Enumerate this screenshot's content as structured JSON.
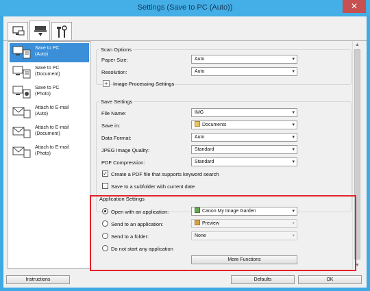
{
  "window": {
    "title": "Settings (Save to PC (Auto))",
    "close_glyph": "✕"
  },
  "tabs": [
    {
      "name": "scan-from-computer-icon",
      "active": false
    },
    {
      "name": "scan-from-operation-panel-icon",
      "active": true
    },
    {
      "name": "general-settings-tools-icon",
      "active": false
    }
  ],
  "left_list": {
    "items": [
      {
        "label_line1": "Save to PC",
        "label_line2": "(Auto)",
        "icon": "save-to-pc-icon",
        "selected": true
      },
      {
        "label_line1": "Save to PC",
        "label_line2": "(Document)",
        "icon": "save-to-pc-icon",
        "selected": false
      },
      {
        "label_line1": "Save to PC",
        "label_line2": "(Photo)",
        "icon": "save-to-pc-icon",
        "selected": false
      },
      {
        "label_line1": "Attach to E-mail",
        "label_line2": "(Auto)",
        "icon": "attach-email-icon",
        "selected": false
      },
      {
        "label_line1": "Attach to E-mail",
        "label_line2": "(Document)",
        "icon": "attach-email-icon",
        "selected": false
      },
      {
        "label_line1": "Attach to E-mail",
        "label_line2": "(Photo)",
        "icon": "attach-email-icon",
        "selected": false
      }
    ]
  },
  "scan_options": {
    "title": "Scan Options",
    "paper_size_label": "Paper Size:",
    "paper_size_value": "Auto",
    "resolution_label": "Resolution:",
    "resolution_value": "Auto",
    "image_processing_label": "Image Processing Settings",
    "expand_glyph": "+"
  },
  "save_settings": {
    "title": "Save Settings",
    "file_name_label": "File Name:",
    "file_name_value": "IMG",
    "save_in_label": "Save in:",
    "save_in_value": "Documents",
    "data_format_label": "Data Format:",
    "data_format_value": "Auto",
    "jpeg_quality_label": "JPEG Image Quality:",
    "jpeg_quality_value": "Standard",
    "pdf_compression_label": "PDF Compression:",
    "pdf_compression_value": "Standard",
    "keyword_pdf_label": "Create a PDF file that supports keyword search",
    "keyword_pdf_checked": true,
    "subfolder_label": "Save to a subfolder with current date",
    "subfolder_checked": false,
    "check_glyph": "✓"
  },
  "application_settings": {
    "title": "Application Settings",
    "open_app_label": "Open with an application:",
    "open_app_value": "Canon My Image Garden",
    "open_app_selected": true,
    "send_app_label": "Send to an application:",
    "send_app_value": "Preview",
    "send_folder_label": "Send to a folder:",
    "send_folder_value": "None",
    "do_not_start_label": "Do not start any application",
    "more_functions_label": "More Functions"
  },
  "footer": {
    "instructions_label": "Instructions",
    "defaults_label": "Defaults",
    "ok_label": "OK"
  },
  "colors": {
    "window_frame": "#3ea9e2",
    "selection": "#3a8fd8",
    "highlight_box": "#e5212a"
  }
}
